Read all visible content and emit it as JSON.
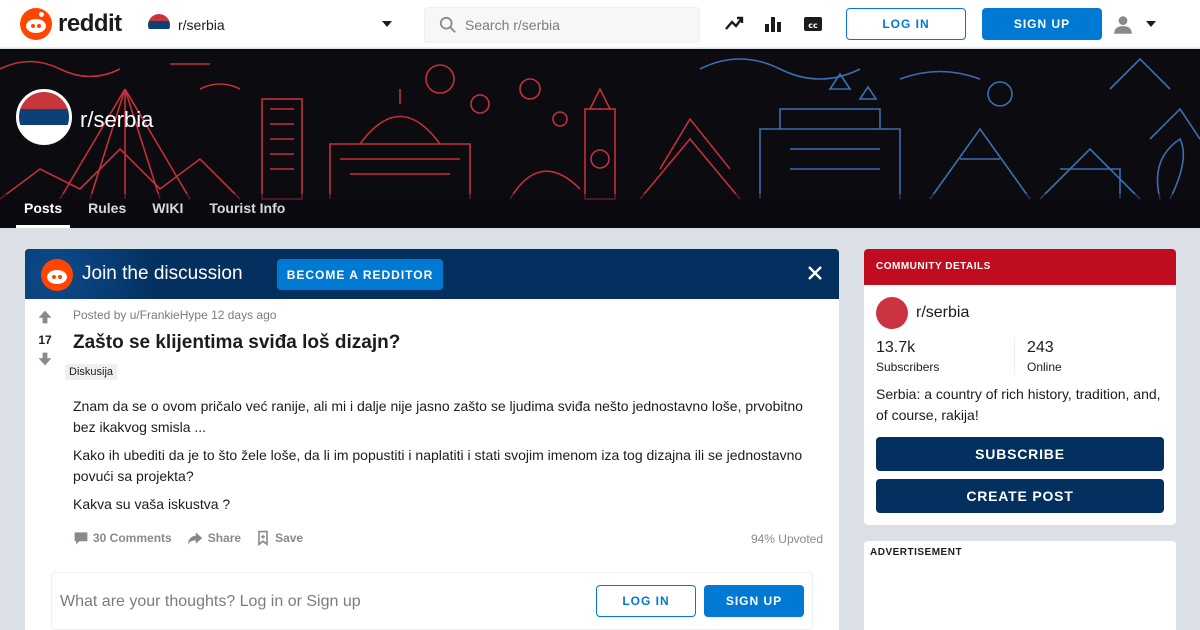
{
  "header": {
    "logo_text": "reddit",
    "subreddit_selector": "r/serbia",
    "search_placeholder": "Search r/serbia",
    "login_label": "LOG IN",
    "signup_label": "SIGN UP",
    "icons": [
      "trending-icon",
      "stats-icon",
      "closed-captions-icon",
      "user-icon",
      "chevron-down-icon"
    ]
  },
  "banner": {
    "subreddit_name": "r/serbia",
    "tabs": [
      {
        "label": "Posts",
        "active": true
      },
      {
        "label": "Rules",
        "active": false
      },
      {
        "label": "WIKI",
        "active": false
      },
      {
        "label": "Tourist Info",
        "active": false
      }
    ]
  },
  "join_bar": {
    "title": "Join the discussion",
    "button_label": "BECOME A REDDITOR"
  },
  "post": {
    "votes": "17",
    "meta": "Posted by u/FrankieHype 12 days ago",
    "title": "Zašto se klijentima sviđa loš dizajn?",
    "flair": "Diskusija",
    "paragraphs": [
      "Znam da se o ovom pričalo već ranije, ali mi i dalje nije jasno zašto se ljudima sviđa nešto jednostavno loše, prvobitno bez ikakvog smisla ...",
      "Kako ih ubediti da je to što žele loše, da li im popustiti i naplatiti i stati svojim imenom iza tog dizajna ili se jednostavno povući sa projekta?",
      "Kakva su vaša iskustva ?"
    ],
    "actions": {
      "comments": "30 Comments",
      "share": "Share",
      "save": "Save"
    },
    "upvoted": "94% Upvoted",
    "comment_box": {
      "placeholder": "What are your thoughts? Log in or Sign up",
      "login_label": "LOG IN",
      "signup_label": "SIGN UP"
    }
  },
  "sidebar": {
    "community_header": "COMMUNITY DETAILS",
    "name": "r/serbia",
    "subscribers_value": "13.7k",
    "subscribers_label": "Subscribers",
    "online_value": "243",
    "online_label": "Online",
    "description": "Serbia: a country of rich history, tradition, and, of course, rakija!",
    "subscribe_label": "SUBSCRIBE",
    "create_post_label": "CREATE POST",
    "advertisement_label": "ADVERTISEMENT"
  },
  "colors": {
    "brand_orange": "#ff4500",
    "link_blue": "#0079d3",
    "community_red": "#bf0c1e",
    "navy": "#03305e"
  }
}
